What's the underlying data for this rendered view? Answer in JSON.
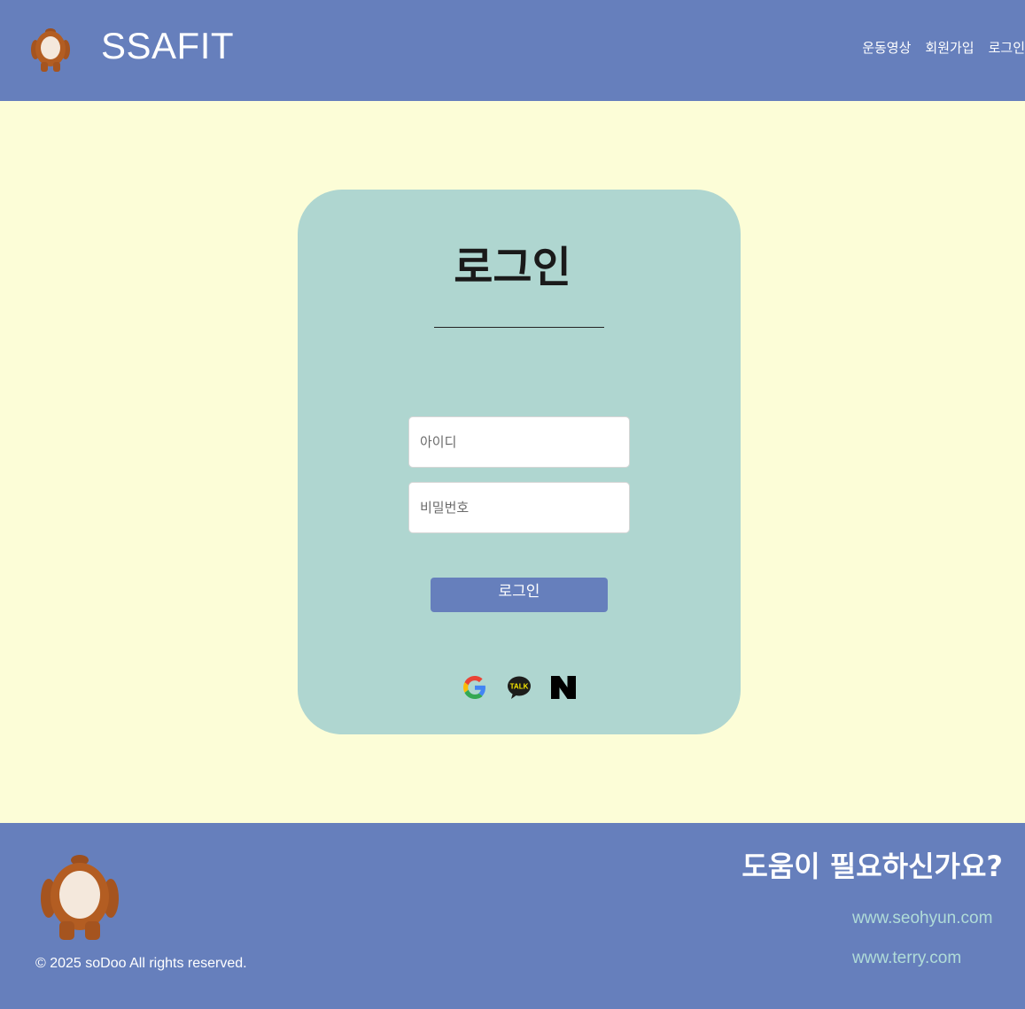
{
  "header": {
    "brand": "SSAFIT",
    "logo_icon": "bear-icon",
    "nav": [
      "운동영상",
      "회원가입",
      "로그인"
    ]
  },
  "login": {
    "title": "로그인",
    "id_placeholder": "아이디",
    "password_placeholder": "비밀번호",
    "submit_label": "로그인",
    "social": [
      {
        "icon": "google-icon"
      },
      {
        "icon": "kakao-talk-icon",
        "text": "TALK"
      },
      {
        "icon": "naver-icon"
      }
    ]
  },
  "footer": {
    "copyright": "© 2025 soDoo All rights reserved.",
    "help_title": "도움이 필요하신가요?",
    "links": [
      "www.seohyun.com",
      "www.terry.com"
    ]
  },
  "colors": {
    "primary": "#667fbc",
    "background": "#fcfdd7",
    "card": "#afd6d0",
    "link": "#b0dcd8"
  }
}
